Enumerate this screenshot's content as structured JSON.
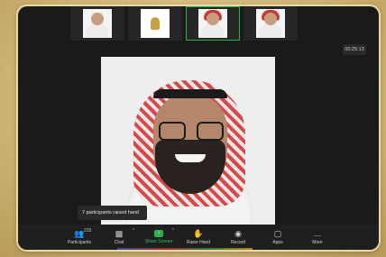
{
  "meeting": {
    "timer": "00:25:13",
    "raised_hand_tooltip": "7 participants raised hand"
  },
  "thumbnails": [
    {
      "kind": "person",
      "active": false
    },
    {
      "kind": "logo",
      "active": false
    },
    {
      "kind": "person",
      "active": true
    },
    {
      "kind": "person",
      "active": false
    }
  ],
  "toolbar": {
    "participants_count": "215",
    "participants_label": "Participants",
    "chat_label": "Chat",
    "share_label": "Share Screen",
    "raise_hand_label": "Raise Hand",
    "record_label": "Record",
    "apps_label": "Apps",
    "more_label": "More"
  },
  "icons": {
    "participants": "participants-icon",
    "chat": "chat-icon",
    "share": "share-screen-icon",
    "raise_hand": "raise-hand-icon",
    "record": "record-icon",
    "apps": "apps-icon",
    "more": "more-icon"
  },
  "colors": {
    "accent_green": "#2bb14a",
    "frame_gold": "#d8c088",
    "meeting_bg": "#1a1a1a"
  }
}
